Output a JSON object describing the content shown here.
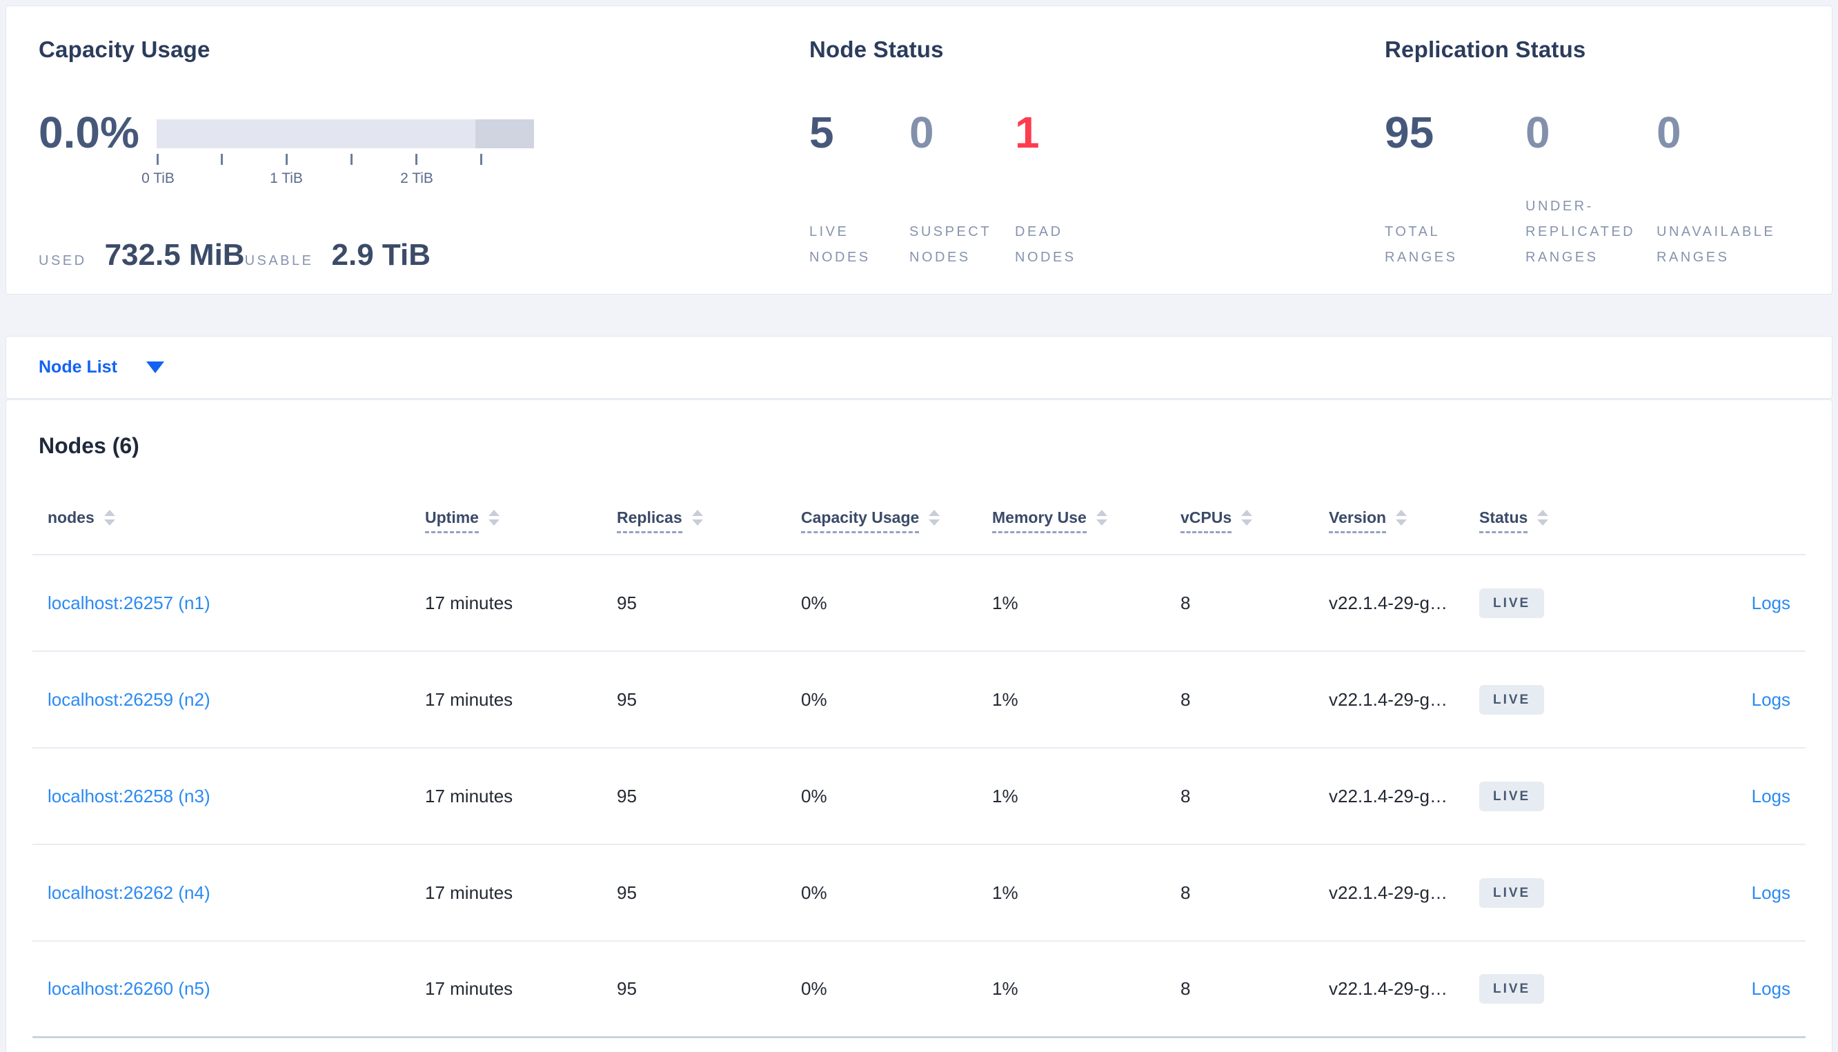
{
  "colors": {
    "action_blue": "#1363f2",
    "link_blue": "#2b8af2",
    "danger_red": "#ff3b4f",
    "primary_stat": "#46587a",
    "secondary_stat": "#8290ac",
    "badge_bg": "#e7ecf3",
    "badge_text": "#475872"
  },
  "panels": {
    "capacity": {
      "title": "Capacity Usage",
      "percent": "0.0%",
      "bar": {
        "light": "#e3e6f0",
        "dark": "#cfd4e0",
        "dark_pct": 15.5
      },
      "ticks": [
        "0 TiB",
        "1 TiB",
        "2 TiB"
      ],
      "used_label": "USED",
      "used_value": "732.5 MiB",
      "usable_label": "USABLE",
      "usable_value": "2.9 TiB"
    },
    "node_status": {
      "title": "Node Status",
      "stats": [
        {
          "value": "5",
          "label": "LIVE\nNODES",
          "color": "#46587a"
        },
        {
          "value": "0",
          "label": "SUSPECT\nNODES",
          "color": "#8290ac"
        },
        {
          "value": "1",
          "label": "DEAD\nNODES",
          "color": "#ff3b4f"
        }
      ]
    },
    "replication": {
      "title": "Replication Status",
      "stats": [
        {
          "value": "95",
          "label": "TOTAL\nRANGES",
          "color": "#46587a"
        },
        {
          "value": "0",
          "label": "UNDER-\nREPLICATED\nRANGES",
          "color": "#8290ac"
        },
        {
          "value": "0",
          "label": "UNAVAILABLE\nRANGES",
          "color": "#8290ac"
        }
      ]
    }
  },
  "node_list_bar": {
    "label": "Node List"
  },
  "nodes_section": {
    "heading": "Nodes (6)",
    "columns": [
      {
        "key": "node",
        "label": "nodes",
        "sortable": true,
        "tooltip": false
      },
      {
        "key": "uptime",
        "label": "Uptime",
        "sortable": true,
        "tooltip": true
      },
      {
        "key": "replicas",
        "label": "Replicas",
        "sortable": true,
        "tooltip": true
      },
      {
        "key": "capacity",
        "label": "Capacity Usage",
        "sortable": true,
        "tooltip": true
      },
      {
        "key": "memory",
        "label": "Memory Use",
        "sortable": true,
        "tooltip": true
      },
      {
        "key": "vcpus",
        "label": "vCPUs",
        "sortable": true,
        "tooltip": true
      },
      {
        "key": "version",
        "label": "Version",
        "sortable": true,
        "tooltip": true
      },
      {
        "key": "status",
        "label": "Status",
        "sortable": true,
        "tooltip": true
      },
      {
        "key": "logs",
        "label": "",
        "sortable": false,
        "tooltip": false
      }
    ],
    "rows": [
      {
        "node": "localhost:26257 (n1)",
        "uptime": "17 minutes",
        "replicas": "95",
        "capacity": "0%",
        "memory": "1%",
        "vcpus": "8",
        "version": "v22.1.4-29-g…",
        "status": "LIVE",
        "logs": "Logs"
      },
      {
        "node": "localhost:26259 (n2)",
        "uptime": "17 minutes",
        "replicas": "95",
        "capacity": "0%",
        "memory": "1%",
        "vcpus": "8",
        "version": "v22.1.4-29-g…",
        "status": "LIVE",
        "logs": "Logs"
      },
      {
        "node": "localhost:26258 (n3)",
        "uptime": "17 minutes",
        "replicas": "95",
        "capacity": "0%",
        "memory": "1%",
        "vcpus": "8",
        "version": "v22.1.4-29-g…",
        "status": "LIVE",
        "logs": "Logs"
      },
      {
        "node": "localhost:26262 (n4)",
        "uptime": "17 minutes",
        "replicas": "95",
        "capacity": "0%",
        "memory": "1%",
        "vcpus": "8",
        "version": "v22.1.4-29-g…",
        "status": "LIVE",
        "logs": "Logs"
      },
      {
        "node": "localhost:26260 (n5)",
        "uptime": "17 minutes",
        "replicas": "95",
        "capacity": "0%",
        "memory": "1%",
        "vcpus": "8",
        "version": "v22.1.4-29-g…",
        "status": "LIVE",
        "logs": "Logs"
      }
    ]
  }
}
